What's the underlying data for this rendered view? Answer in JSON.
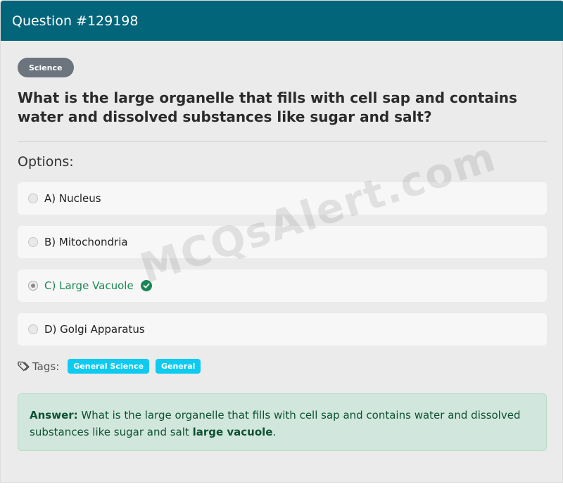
{
  "header": {
    "title": "Question #129198"
  },
  "category": "Science",
  "question": "What is the large organelle that fills with cell sap and contains water and dissolved substances like sugar and salt?",
  "options_heading": "Options:",
  "options": [
    {
      "label": "A) Nucleus",
      "selected": false,
      "correct": false
    },
    {
      "label": "B) Mitochondria",
      "selected": false,
      "correct": false
    },
    {
      "label": "C) Large Vacuole",
      "selected": true,
      "correct": true
    },
    {
      "label": "D) Golgi Apparatus",
      "selected": false,
      "correct": false
    }
  ],
  "watermark": "MCQsAlert.com",
  "tags": {
    "label": "Tags:",
    "items": [
      "General Science",
      "General"
    ]
  },
  "answer": {
    "prefix": "Answer:",
    "text": " What is the large organelle that fills with cell sap and contains water and dissolved substances like sugar and salt ",
    "highlight": "large vacuole",
    "suffix": "."
  },
  "colors": {
    "header_bg": "#03657a",
    "correct": "#198754",
    "tag_bg": "#0dcaf0",
    "answer_bg": "#d1e7dd"
  }
}
